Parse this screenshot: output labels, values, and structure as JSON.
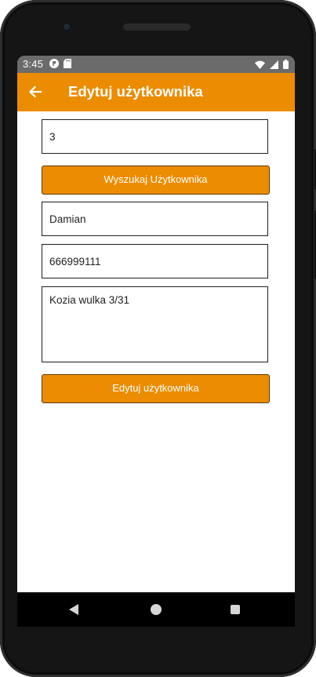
{
  "status_bar": {
    "time": "3:45",
    "left_icons": [
      "p-circle-icon",
      "sd-card-icon"
    ],
    "right_icons": [
      "wifi-icon",
      "signal-icon",
      "battery-icon"
    ]
  },
  "app_bar": {
    "title": "Edytuj użytkownika",
    "back_icon": "arrow-left-icon",
    "color": "#ec8c00"
  },
  "form": {
    "user_id": {
      "value": "3"
    },
    "search_button": {
      "label": "Wyszukaj Użytkownika"
    },
    "name": {
      "value": "Damian"
    },
    "phone": {
      "value": "666999111"
    },
    "address": {
      "value": "Kozia wulka 3/31"
    },
    "edit_button": {
      "label": "Edytuj użytkownika"
    }
  },
  "nav_bar": {
    "icons": [
      "back-triangle-icon",
      "home-circle-icon",
      "recents-square-icon"
    ]
  }
}
